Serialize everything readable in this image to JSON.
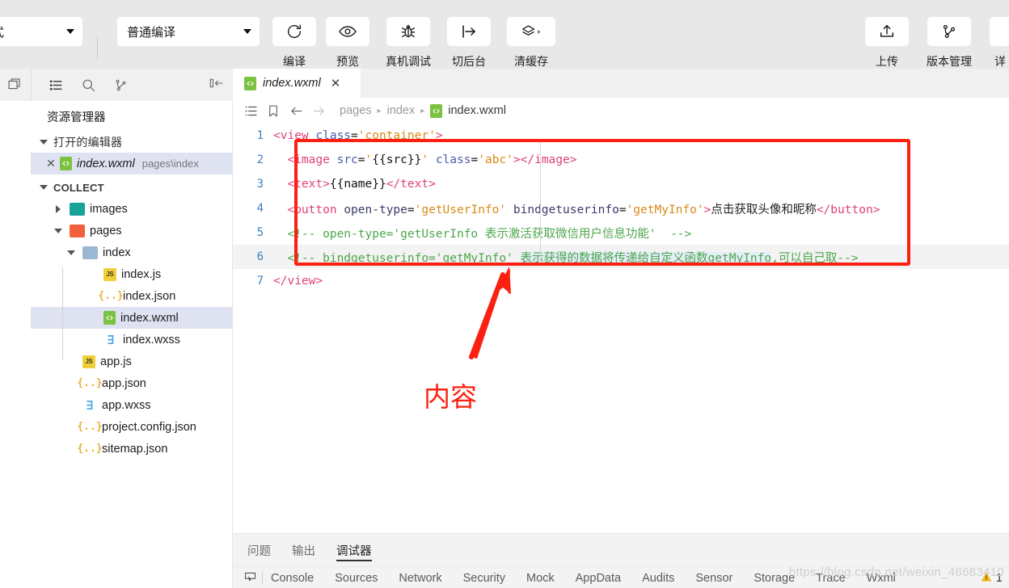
{
  "toolbar": {
    "mode_select": {
      "value": "式",
      "icon": "chevron-down-icon"
    },
    "compile_select": {
      "value": "普通编译",
      "icon": "chevron-down-icon"
    },
    "buttons": [
      {
        "label": "编译",
        "icon": "refresh-icon"
      },
      {
        "label": "预览",
        "icon": "eye-icon"
      },
      {
        "label": "真机调试",
        "icon": "bug-icon"
      },
      {
        "label": "切后台",
        "icon": "send-to-back-icon"
      },
      {
        "label": "清缓存",
        "icon": "layers-icon"
      }
    ],
    "right_buttons": [
      {
        "label": "上传",
        "icon": "upload-icon"
      },
      {
        "label": "版本管理",
        "icon": "git-branch-icon"
      },
      {
        "label": "详",
        "icon": "details-icon"
      }
    ]
  },
  "side_header": {
    "icons": [
      "panel-toggle-icon",
      "explorer-list-icon",
      "search-icon",
      "source-control-icon",
      "collapse-sidebar-icon"
    ]
  },
  "sidebar": {
    "title": "资源管理器",
    "open_editors": {
      "label": "打开的编辑器",
      "expanded": true,
      "items": [
        {
          "name": "index.wxml",
          "path": "pages\\index",
          "icon": "wxml-file-icon",
          "selected": true,
          "close": "✕"
        }
      ]
    },
    "project": {
      "label": "COLLECT",
      "expanded": true,
      "items": [
        {
          "name": "images",
          "type": "folder",
          "icon": "folder-images-icon",
          "expanded": false,
          "depth": 1
        },
        {
          "name": "pages",
          "type": "folder",
          "icon": "folder-pages-icon",
          "expanded": true,
          "depth": 1
        },
        {
          "name": "index",
          "type": "folder",
          "icon": "folder-icon",
          "expanded": true,
          "depth": 2
        },
        {
          "name": "index.js",
          "type": "js",
          "icon": "js-file-icon",
          "depth": 3
        },
        {
          "name": "index.json",
          "type": "json",
          "icon": "json-file-icon",
          "depth": 3
        },
        {
          "name": "index.wxml",
          "type": "wxml",
          "icon": "wxml-file-icon",
          "depth": 3,
          "selected": true
        },
        {
          "name": "index.wxss",
          "type": "wxss",
          "icon": "wxss-file-icon",
          "depth": 3
        },
        {
          "name": "app.js",
          "type": "js",
          "icon": "js-file-icon",
          "depth": 2
        },
        {
          "name": "app.json",
          "type": "json",
          "icon": "json-file-icon",
          "depth": 2
        },
        {
          "name": "app.wxss",
          "type": "wxss",
          "icon": "wxss-file-icon",
          "depth": 2
        },
        {
          "name": "project.config.json",
          "type": "json",
          "icon": "json-file-icon",
          "depth": 2
        },
        {
          "name": "sitemap.json",
          "type": "json",
          "icon": "json-file-icon",
          "depth": 2
        }
      ]
    }
  },
  "editor": {
    "tab": {
      "label": "index.wxml",
      "close": "✕",
      "icon": "wxml-file-icon"
    },
    "breadcrumb": {
      "icons": [
        "outline-icon",
        "bookmark-icon",
        "back-arrow-icon",
        "forward-arrow-icon"
      ],
      "crumbs": [
        "pages",
        "index"
      ],
      "file": "index.wxml",
      "separator": "▸"
    },
    "lines": [
      {
        "n": "1",
        "text": "<view class='container'>"
      },
      {
        "n": "2",
        "text": "  <image src='{{src}}' class='abc'></image>"
      },
      {
        "n": "3",
        "text": "  <text>{{name}}</text>"
      },
      {
        "n": "4",
        "text": "  <button open-type='getUserInfo' bindgetuserinfo='getMyInfo'>点击获取头像和昵称</button>"
      },
      {
        "n": "5",
        "text": "  <!-- open-type='getUserInfo 表示激活获取微信用户信息功能'  -->"
      },
      {
        "n": "6",
        "text": "  <!-- bindgetuserinfo='getMyInfo' 表示获得的数据将传递给自定义函数getMyInfo,可以自己取-->",
        "highlighted": true
      },
      {
        "n": "7",
        "text": "</view>"
      }
    ]
  },
  "annotation": {
    "label": "内容",
    "box_color": "#fb2011"
  },
  "bottom_panel": {
    "tabs": [
      {
        "label": "问题",
        "active": false
      },
      {
        "label": "输出",
        "active": false
      },
      {
        "label": "调试器",
        "active": true
      }
    ],
    "devtools_icon": "inspect-element-icon",
    "devtools_tabs": [
      "Console",
      "Sources",
      "Network",
      "Security",
      "Mock",
      "AppData",
      "Audits",
      "Sensor",
      "Storage",
      "Trace",
      "Wxml"
    ],
    "warning": {
      "icon": "warning-triangle-icon",
      "count": "1"
    }
  },
  "watermark": "https://blog.csdn.net/weixin_48683410"
}
